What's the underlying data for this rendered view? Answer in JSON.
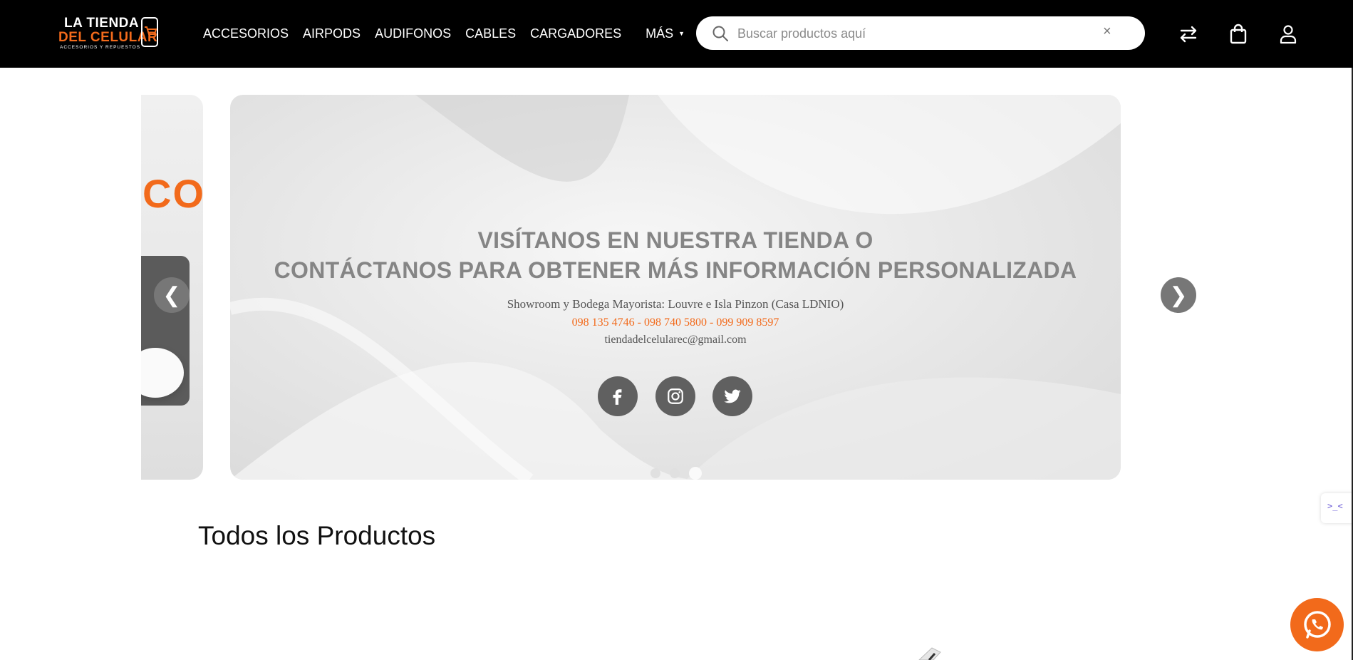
{
  "brand": {
    "line1": "LA TIENDA",
    "line2": "DEL CELULAR",
    "tagline": "ACCESORIOS Y REPUESTOS"
  },
  "nav": {
    "items": [
      "ACCESORIOS",
      "AIRPODS",
      "AUDIFONOS",
      "CABLES",
      "CARGADORES"
    ],
    "more_label": "MÁS"
  },
  "search": {
    "placeholder": "Buscar productos aquí",
    "value": "",
    "clear_glyph": "×"
  },
  "header_icons": [
    "compare-arrows-icon",
    "shopping-bag-icon",
    "user-icon"
  ],
  "carousel": {
    "prev_glyph": "❮",
    "next_glyph": "❯",
    "prev_slide_text": "CO",
    "headline_line1": "VISÍTANOS EN NUESTRA TIENDA O",
    "headline_line2": "CONTÁCTANOS PARA OBTENER MÁS INFORMACIÓN PERSONALIZADA",
    "showroom": "Showroom y Bodega Mayorista: Louvre e Isla Pinzon (Casa LDNIO)",
    "phones": "098 135 4746 - 098 740 5800 - 099 909 8597",
    "email": "tiendadelcelularec@gmail.com",
    "social": [
      "facebook-icon",
      "instagram-icon",
      "twitter-icon"
    ],
    "dot_count": 3,
    "active_dot": 3
  },
  "section": {
    "title": "Todos los Productos"
  },
  "colors": {
    "header_bg": "#000000",
    "accent": "#f26a1b",
    "social_bg": "#606060"
  }
}
